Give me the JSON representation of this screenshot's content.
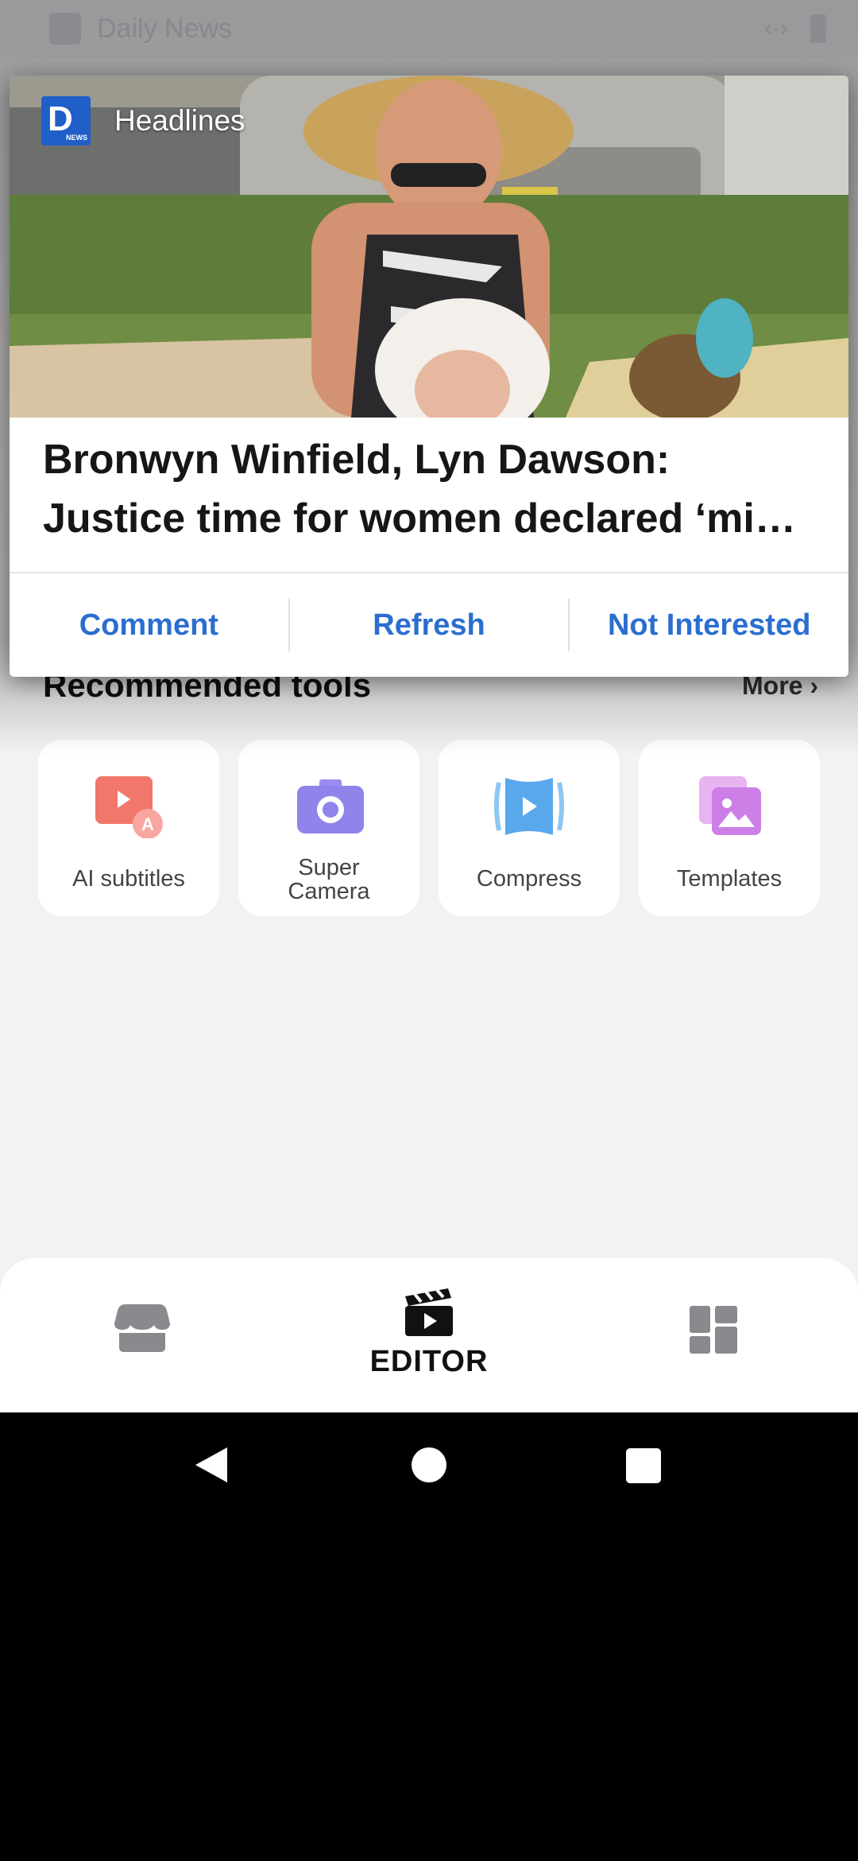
{
  "status_bar": {
    "app_name": "Daily News"
  },
  "notification": {
    "source_label": "Headlines",
    "logo_icon": "daily-news-logo",
    "title_line1": "Bronwyn Winfield, Lyn Dawson:",
    "title_line2": "Justice time for women declared ‘mi…",
    "actions": {
      "comment": "Comment",
      "refresh": "Refresh",
      "not_interested": "Not Interested"
    },
    "action_color": "#2b6ed0"
  },
  "recommended": {
    "title": "Recommended tools",
    "more": "More"
  },
  "tools": [
    {
      "label": "AI subtitles",
      "icon": "ai-subtitles-icon"
    },
    {
      "label": "Super Camera",
      "icon": "camera-icon"
    },
    {
      "label": "Compress",
      "icon": "compress-icon"
    },
    {
      "label": "Templates",
      "icon": "templates-icon"
    }
  ],
  "bottom_nav": {
    "store_icon": "store-icon",
    "editor_label": "EDITOR",
    "editor_icon": "clapperboard-icon",
    "grid_icon": "grid-icon"
  },
  "system_nav": [
    "back-icon",
    "home-icon",
    "recents-icon"
  ]
}
